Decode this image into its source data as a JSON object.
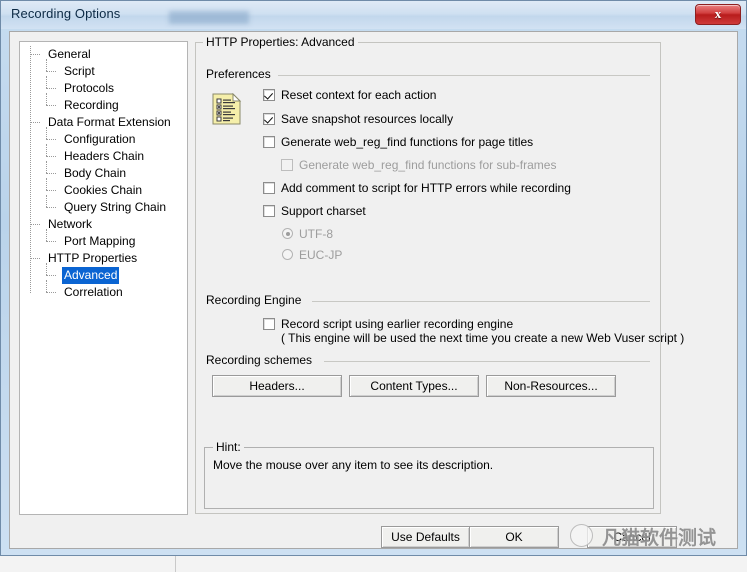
{
  "window": {
    "title": "Recording Options",
    "close_label": "x"
  },
  "tree": {
    "items": [
      {
        "label": "General",
        "level": 0,
        "selected": false
      },
      {
        "label": "Script",
        "level": 1,
        "selected": false
      },
      {
        "label": "Protocols",
        "level": 1,
        "selected": false
      },
      {
        "label": "Recording",
        "level": 1,
        "selected": false
      },
      {
        "label": "Data Format Extension",
        "level": 0,
        "selected": false
      },
      {
        "label": "Configuration",
        "level": 1,
        "selected": false
      },
      {
        "label": "Headers Chain",
        "level": 1,
        "selected": false
      },
      {
        "label": "Body Chain",
        "level": 1,
        "selected": false
      },
      {
        "label": "Cookies Chain",
        "level": 1,
        "selected": false
      },
      {
        "label": "Query String Chain",
        "level": 1,
        "selected": false
      },
      {
        "label": "Network",
        "level": 0,
        "selected": false
      },
      {
        "label": "Port Mapping",
        "level": 1,
        "selected": false
      },
      {
        "label": "HTTP Properties",
        "level": 0,
        "selected": false
      },
      {
        "label": "Advanced",
        "level": 1,
        "selected": true
      },
      {
        "label": "Correlation",
        "level": 1,
        "selected": false
      }
    ]
  },
  "main": {
    "group_title": "HTTP Properties: Advanced",
    "preferences": {
      "section_label": "Preferences",
      "icon": "preferences-list-icon",
      "checkboxes": [
        {
          "label": "Reset context for each action",
          "checked": true,
          "disabled": false,
          "indent": 0
        },
        {
          "label": "Save snapshot resources locally",
          "checked": true,
          "disabled": false,
          "indent": 0
        },
        {
          "label": "Generate web_reg_find functions for page titles",
          "checked": false,
          "disabled": false,
          "indent": 0
        },
        {
          "label": "Generate web_reg_find functions for sub-frames",
          "checked": false,
          "disabled": true,
          "indent": 1
        },
        {
          "label": "Add comment to script for HTTP errors while recording",
          "checked": false,
          "disabled": false,
          "indent": 0
        },
        {
          "label": "Support charset",
          "checked": false,
          "disabled": false,
          "indent": 0
        }
      ],
      "charset_radios": [
        {
          "label": "UTF-8",
          "selected": true,
          "disabled": true
        },
        {
          "label": "EUC-JP",
          "selected": false,
          "disabled": true
        }
      ]
    },
    "recording_engine": {
      "section_label": "Recording Engine",
      "checkbox": {
        "label": "Record script using earlier recording engine",
        "checked": false,
        "disabled": false
      },
      "note": "( This engine will be used the next time you create a new Web Vuser script )"
    },
    "recording_schemes": {
      "section_label": "Recording schemes",
      "buttons": [
        {
          "label": "Headers..."
        },
        {
          "label": "Content Types..."
        },
        {
          "label": "Non-Resources..."
        }
      ]
    },
    "hint": {
      "title": "Hint:",
      "text": "Move the mouse over any item to see its description."
    }
  },
  "footer": {
    "buttons": [
      {
        "label": "Use Defaults"
      },
      {
        "label": "OK"
      },
      {
        "label": "Cancel"
      }
    ]
  },
  "watermark": {
    "text": "凡猫软件测试"
  },
  "colors": {
    "selection_blue": "#0a64d2",
    "close_red": "#c02f2f",
    "dialog_face": "#f0f0f0",
    "title_blue": "#c6dcf0"
  }
}
